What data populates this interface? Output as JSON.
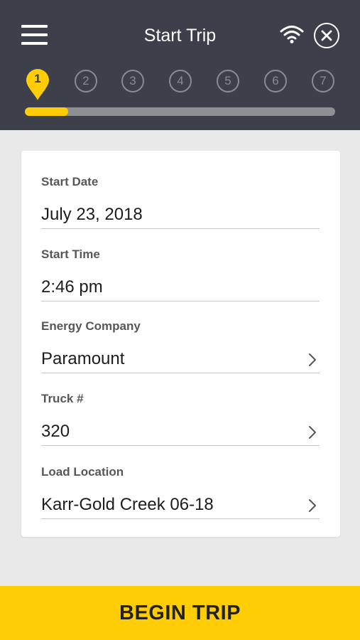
{
  "header": {
    "title": "Start Trip"
  },
  "steps": [
    {
      "label": "1",
      "active": true
    },
    {
      "label": "2"
    },
    {
      "label": "3"
    },
    {
      "label": "4"
    },
    {
      "label": "5"
    },
    {
      "label": "6"
    },
    {
      "label": "7"
    }
  ],
  "progress": {
    "completed_fraction": 0.14
  },
  "form": {
    "start_date": {
      "label": "Start Date",
      "value": "July 23, 2018"
    },
    "start_time": {
      "label": "Start Time",
      "value": "2:46 pm"
    },
    "energy_company": {
      "label": "Energy Company",
      "value": "Paramount"
    },
    "truck": {
      "label": "Truck #",
      "value": "320"
    },
    "load_location": {
      "label": "Load Location",
      "value": "Karr-Gold Creek 06-18"
    }
  },
  "actions": {
    "begin_label": "BEGIN TRIP"
  },
  "icons": {
    "menu": "hamburger-icon",
    "wifi": "wifi-icon",
    "close": "close-circle-icon",
    "chevron": "chevron-right-icon",
    "active_step": "map-pin-icon"
  },
  "colors": {
    "header_bg": "#3d3f4b",
    "accent": "#ffcd05",
    "page_bg": "#e9e9e9"
  }
}
